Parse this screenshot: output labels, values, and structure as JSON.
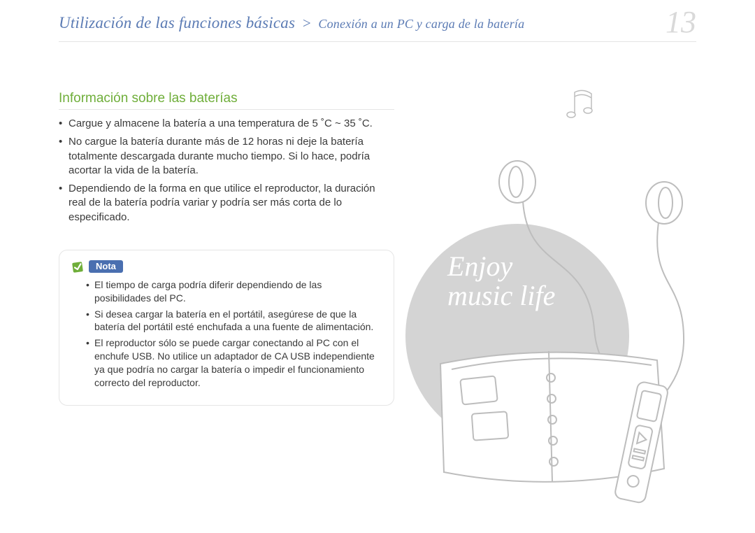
{
  "header": {
    "breadcrumb_main": "Utilización de las funciones básicas",
    "breadcrumb_sep": ">",
    "breadcrumb_sub": "Conexión a un PC y carga de la batería",
    "page_number": "13"
  },
  "section": {
    "title": "Información sobre las baterías",
    "bullets": [
      "Cargue y almacene la batería a una temperatura de 5 ˚C ~ 35 ˚C.",
      "No cargue la batería durante más de 12 horas ni deje la batería totalmente descargada durante mucho tiempo. Si lo hace, podría acortar la vida de la batería.",
      "Dependiendo de la forma en que utilice el reproductor, la duración real de la batería podría variar y podría ser más corta de lo especificado."
    ]
  },
  "note": {
    "label": "Nota",
    "bullets": [
      "El tiempo de carga podría diferir dependiendo de las posibilidades del PC.",
      "Si desea cargar la batería en el portátil, asegúrese de que la batería del portátil esté enchufada a una fuente de alimentación.",
      "El reproductor sólo se puede cargar conectando al PC con el enchufe USB. No utilice un adaptador de CA USB independiente ya que podría no cargar la batería o impedir el funcionamiento correcto del reproductor."
    ]
  },
  "illustration": {
    "text": "Enjoy\nmusic life"
  }
}
